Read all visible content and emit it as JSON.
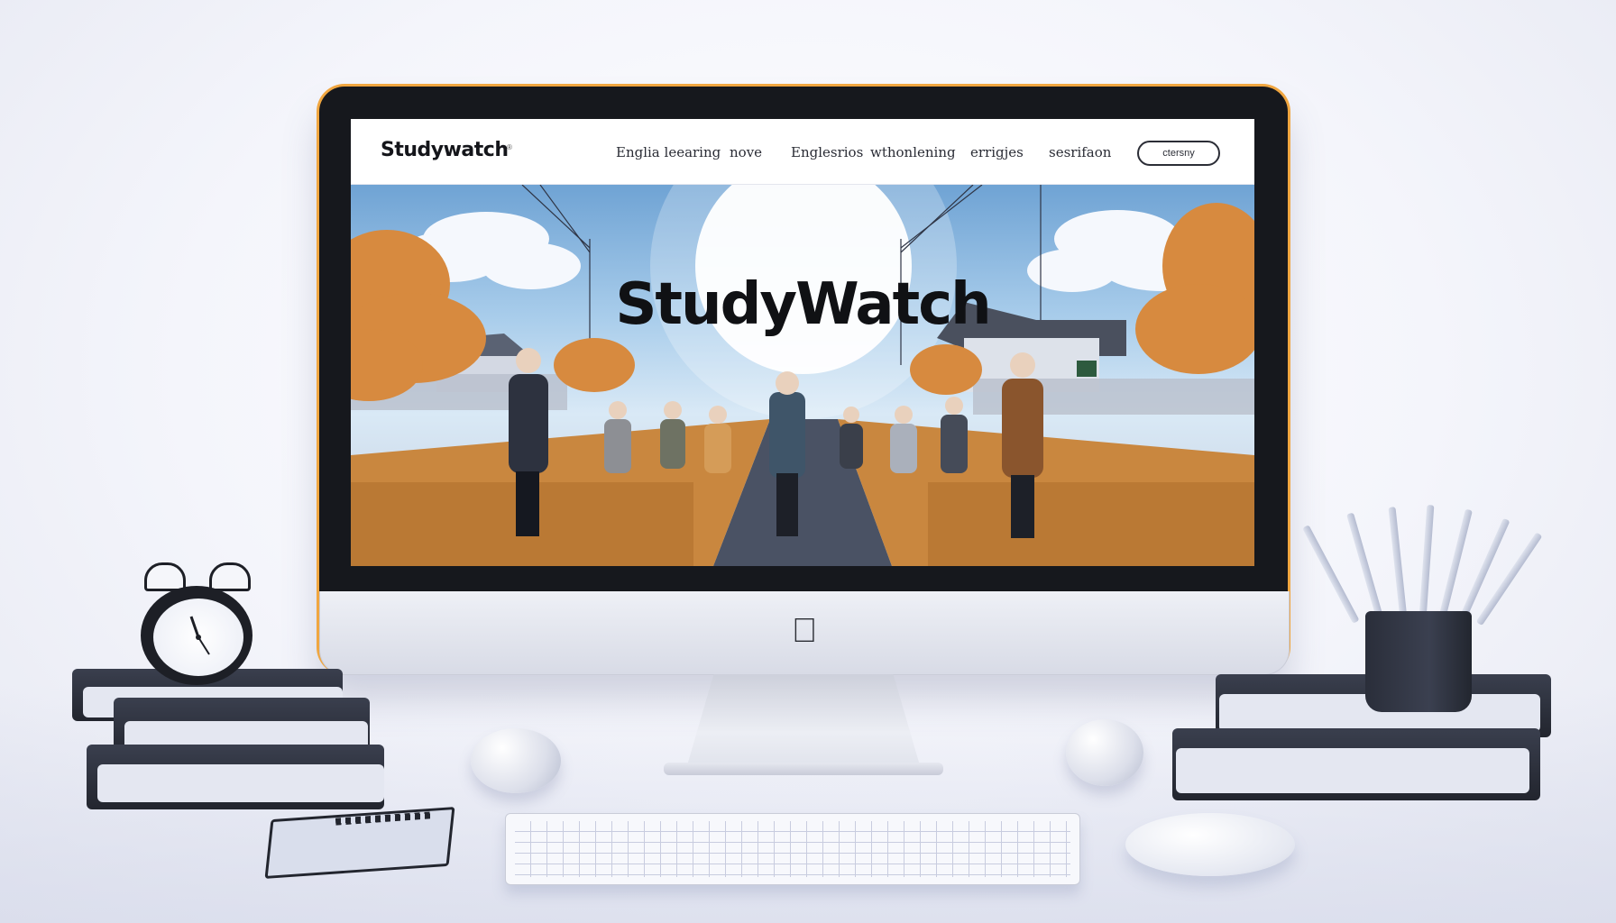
{
  "site": {
    "brand": "Studywatch",
    "brand_mark": "®",
    "nav": [
      {
        "label": "Englia leearing"
      },
      {
        "label": "nove"
      },
      {
        "label": "Englesrios"
      },
      {
        "label": "wthonlening"
      },
      {
        "label": "errigjes"
      },
      {
        "label": "sesrifaon"
      }
    ],
    "cta_label": "ctersny",
    "hero_title": "StudyWatch"
  },
  "device": {
    "logo_icon": "apple-logo-icon",
    "accent_color": "#f0a640"
  },
  "colors": {
    "sky": "#8fbde6",
    "foliage": "#d7893e",
    "screen_bezel": "#16181d",
    "desk_items": "#2a2e3a"
  }
}
